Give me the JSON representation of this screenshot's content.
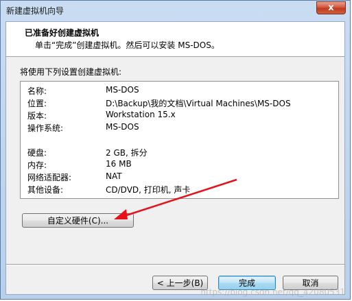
{
  "window": {
    "title": "新建虚拟机向导",
    "close_glyph": "x"
  },
  "header": {
    "title": "已准备好创建虚拟机",
    "subtitle": "单击“完成”创建虚拟机。然后可以安装 MS-DOS。"
  },
  "settings": {
    "label": "将使用下列设置创建虚拟机:",
    "rows_top": [
      {
        "key": "名称:",
        "value": "MS-DOS"
      },
      {
        "key": "位置:",
        "value": "D:\\Backup\\我的文档\\Virtual Machines\\MS-DOS"
      },
      {
        "key": "版本:",
        "value": "Workstation 15.x"
      },
      {
        "key": "操作系统:",
        "value": "MS-DOS"
      }
    ],
    "rows_bottom": [
      {
        "key": "硬盘:",
        "value": "2 GB, 拆分"
      },
      {
        "key": "内存:",
        "value": "16 MB"
      },
      {
        "key": "网络适配器:",
        "value": "NAT"
      },
      {
        "key": "其他设备:",
        "value": "CD/DVD, 打印机, 声卡"
      }
    ]
  },
  "buttons": {
    "customize": "自定义硬件(C)...",
    "back": "< 上一步(B)",
    "finish": "完成",
    "cancel": "取消"
  },
  "annotation": {
    "arrow_color": "#e8101a"
  },
  "watermark": "https://blog.csdn.net/qq_42080531"
}
